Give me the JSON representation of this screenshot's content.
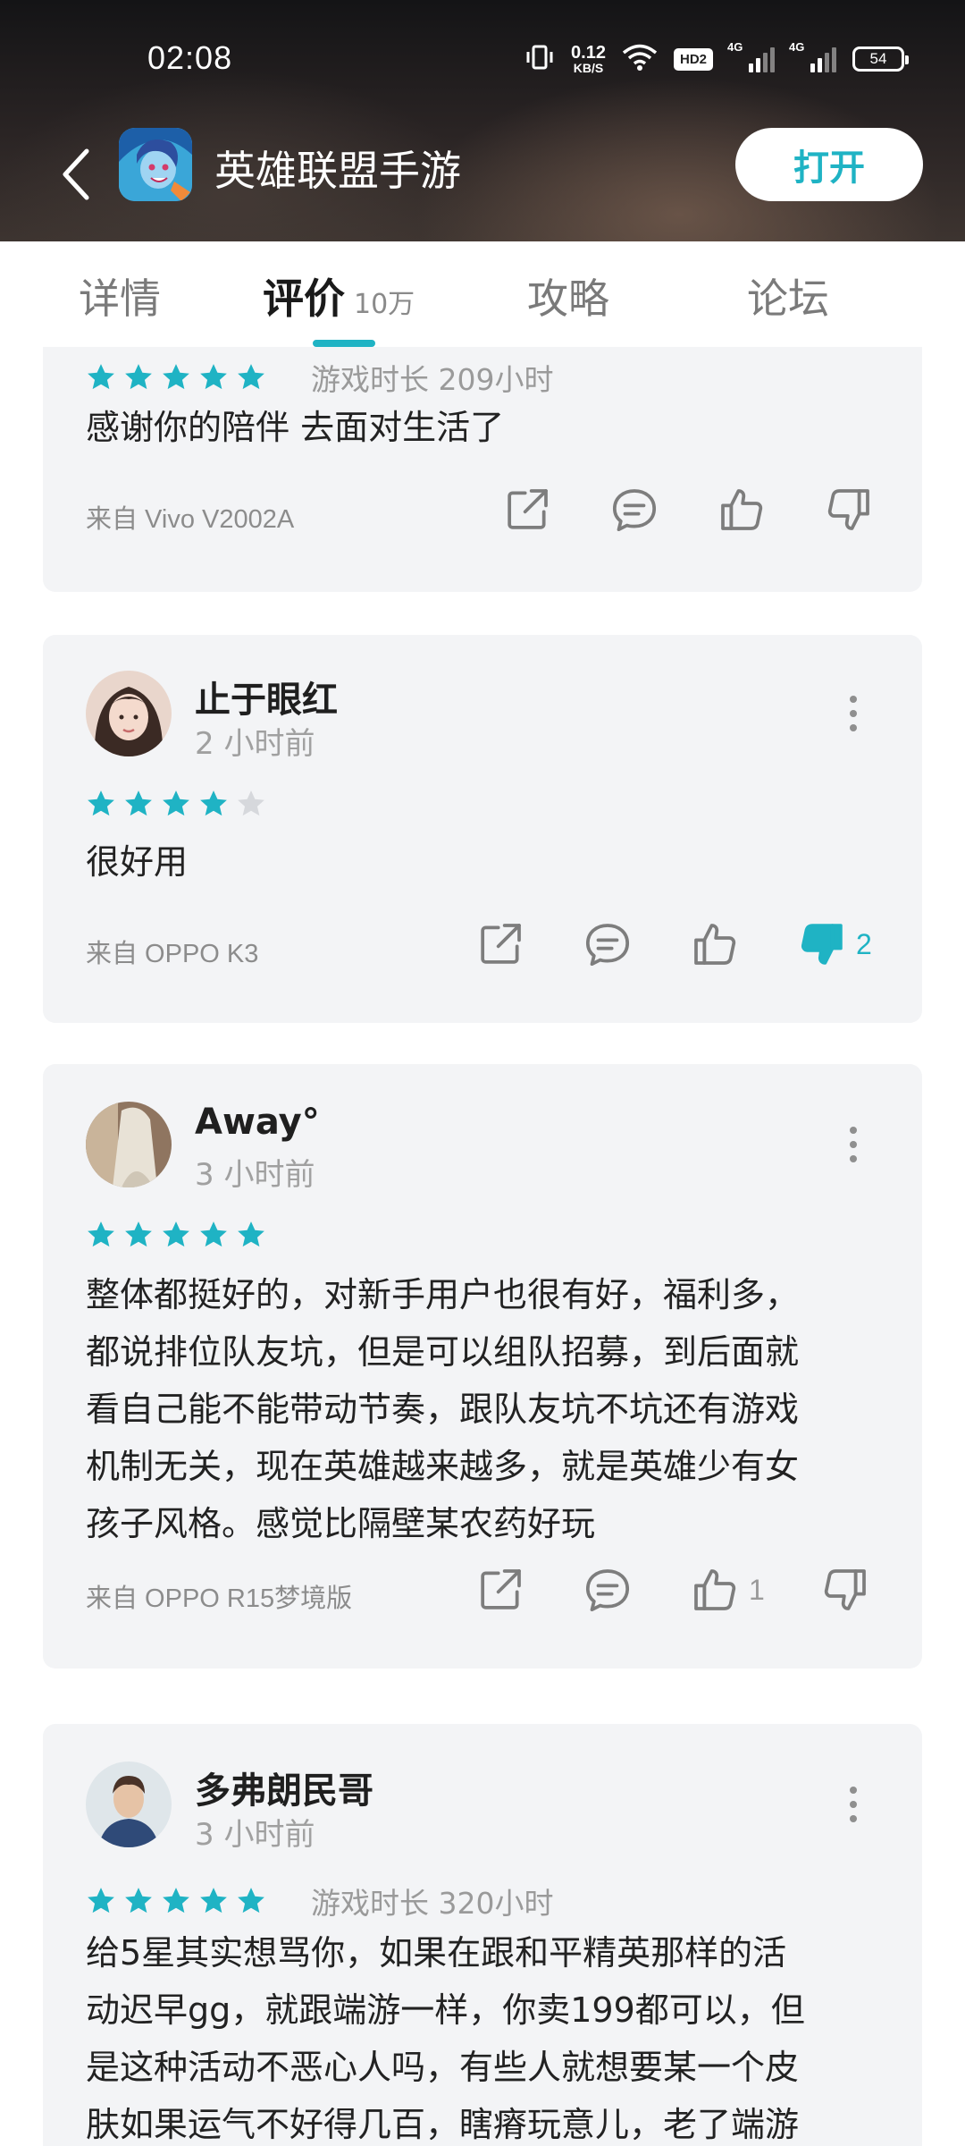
{
  "status_bar": {
    "time": "02:08",
    "net_speed_value": "0.12",
    "net_speed_unit": "KB/S",
    "hd_label": "HD2",
    "sim1_label": "4G",
    "sim2_label": "4G",
    "battery": "54"
  },
  "header": {
    "app_name": "英雄联盟手游",
    "open_button": "打开"
  },
  "tabs": [
    {
      "label": "详情",
      "count": ""
    },
    {
      "label": "评价",
      "count": "10万"
    },
    {
      "label": "攻略",
      "count": ""
    },
    {
      "label": "论坛",
      "count": ""
    }
  ],
  "colors": {
    "accent": "#1fb3c4",
    "card_bg": "#f3f4f6",
    "star_empty": "#d6d8dc"
  },
  "reviews": [
    {
      "user": "",
      "time": "",
      "stars": 5,
      "playtime": "游戏时长 209小时",
      "text": "感谢你的陪伴 去面对生活了",
      "device": "来自 Vivo V2002A",
      "likes": "",
      "dislikes": "",
      "disliked": false
    },
    {
      "user": "止于眼红",
      "time": "2 小时前",
      "stars": 4,
      "playtime": "",
      "text": "很好用",
      "device": "来自 OPPO K3",
      "likes": "",
      "dislikes": "2",
      "disliked": true
    },
    {
      "user": "Away°",
      "time": "3 小时前",
      "stars": 5,
      "playtime": "",
      "text_lines": [
        "整体都挺好的，对新手用户也很有好，福利多，",
        "都说排位队友坑，但是可以组队招募，到后面就",
        "看自己能不能带动节奏，跟队友坑不坑还有游戏",
        "机制无关，现在英雄越来越多，就是英雄少有女",
        "孩子风格。感觉比隔壁某农药好玩"
      ],
      "device": "来自 OPPO R15梦境版",
      "likes": "1",
      "dislikes": "",
      "disliked": false
    },
    {
      "user": "多弗朗民哥",
      "time": "3 小时前",
      "stars": 5,
      "playtime": "游戏时长 320小时",
      "text_lines": [
        "给5星其实想骂你，如果在跟和平精英那样的活",
        "动迟早gg，就跟端游一样，你卖199都可以，但",
        "是这种活动不恶心人吗，有些人就想要某一个皮",
        "肤如果运气不好得几百，瞎瘠玩意儿，老了端游"
      ]
    }
  ]
}
